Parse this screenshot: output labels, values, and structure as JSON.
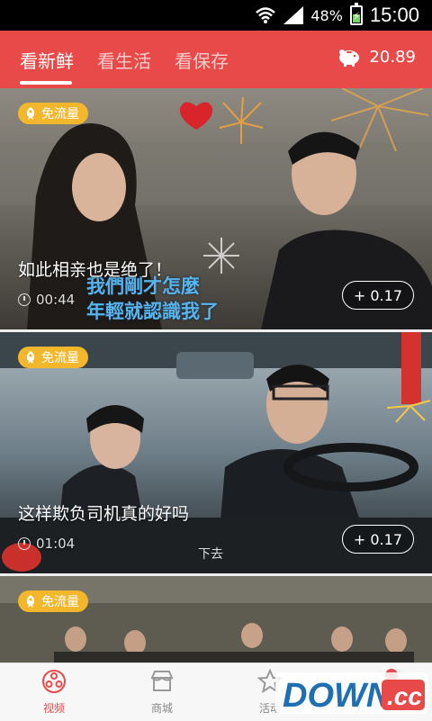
{
  "status_bar": {
    "battery_percent": "48%",
    "time": "15:00"
  },
  "top_nav": {
    "tabs": [
      {
        "label": "看新鲜",
        "active": true
      },
      {
        "label": "看生活",
        "active": false
      },
      {
        "label": "看保存",
        "active": false
      }
    ],
    "balance": "20.89",
    "accent_color": "#e84a4a"
  },
  "feed": [
    {
      "badge": "免流量",
      "title": "如此相亲也是绝了！",
      "duration": "00:44",
      "reward": "+ 0.17",
      "subtitle_lines": [
        "我們剛才怎麼",
        "年輕就認識我了"
      ]
    },
    {
      "badge": "免流量",
      "title": "这样欺负司机真的好吗",
      "duration": "01:04",
      "reward": "+ 0.17",
      "caption": "下去"
    },
    {
      "badge": "免流量"
    }
  ],
  "bottom_nav": {
    "items": [
      {
        "label": "视频",
        "icon": "film-reel-icon",
        "active": true
      },
      {
        "label": "商城",
        "icon": "shop-icon",
        "active": false
      },
      {
        "label": "活动",
        "icon": "star-icon",
        "active": false
      }
    ],
    "watermark": "DOWN.cc"
  }
}
